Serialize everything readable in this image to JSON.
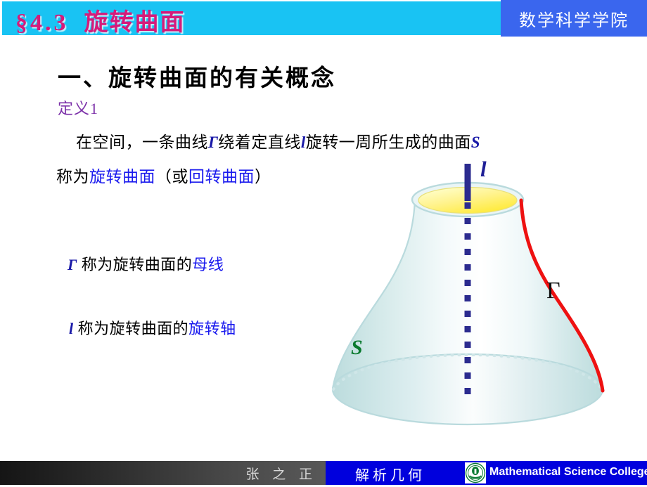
{
  "header": {
    "section_number": "§4.3",
    "section_title": "旋转曲面",
    "college": "数学科学学院",
    "cyan_color": "#19c3f3",
    "blue_color": "#3a66ee",
    "title_color": "#d61a7a"
  },
  "content": {
    "section_heading": "一、旋转曲面的有关概念",
    "definition_label": "定义1",
    "definition_line1": {
      "part1": "在空间，一条曲线",
      "symbol_curve": "Γ",
      "part2": "绕着定直线",
      "symbol_axis": "l",
      "part3": "旋转一周所生成的曲面",
      "symbol_surface": "S"
    },
    "definition_line2": {
      "part1": "称为",
      "term1": "旋转曲面",
      "part2": "（或",
      "term2": "回转曲面",
      "part3": "）"
    },
    "generatrix_line": {
      "symbol": "Γ",
      "part1": "称为旋转曲面的",
      "term": "母线"
    },
    "axis_line": {
      "symbol": "l",
      "part1": "称为旋转曲面的",
      "term": "旋转轴"
    },
    "purple_color": "#7b2fa8",
    "blue_text_color": "#1a1aee"
  },
  "figure": {
    "label_axis": "l",
    "label_curve": "Γ",
    "label_surface": "S",
    "axis_color": "#1f1f96",
    "curve_color": "#ee1111",
    "surface_label_color": "#0a7a2e",
    "surface_fill_light": "#ffffff",
    "surface_fill_edge": "#c3e0e0",
    "top_ellipse_fill": "#ffef4a",
    "outline_color": "#b9dadd",
    "description": "surface of revolution (bell/funnel shape) with yellow elliptical top opening, dashed vertical rotation axis, red generatrix curve on right"
  },
  "footer": {
    "author": "张 之 正",
    "course": "解析几何",
    "college_en": "Mathematical Science College",
    "seal_icon": "university-seal-icon",
    "blue_color": "#0000dd"
  }
}
